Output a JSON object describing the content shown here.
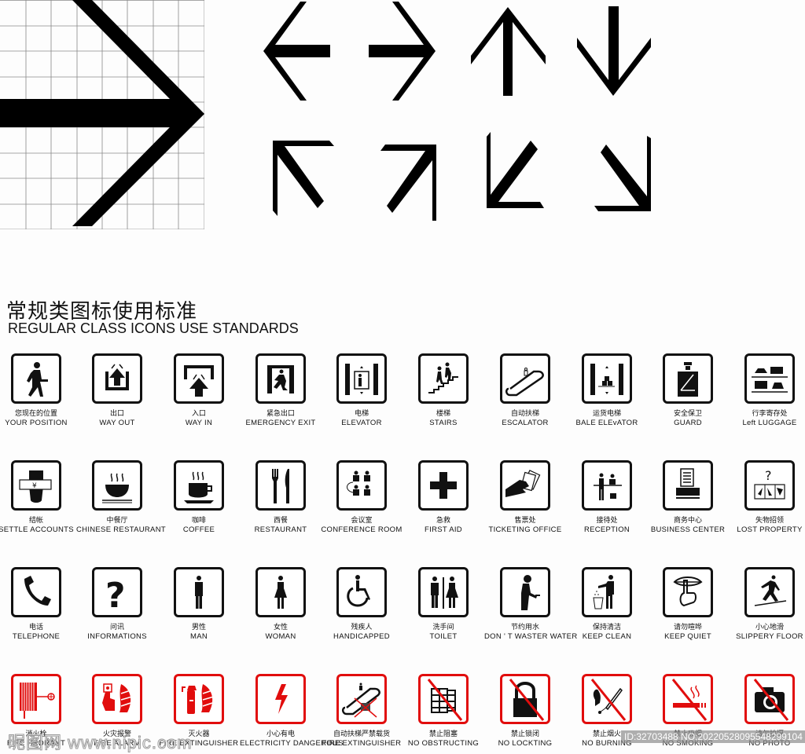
{
  "heading": {
    "title_cn": "常规类图标使用标准",
    "title_en": "REGULAR CLASS ICONS USE STANDARDS"
  },
  "arrows": [
    {
      "icon": "arrow-left-icon"
    },
    {
      "icon": "arrow-right-icon"
    },
    {
      "icon": "arrow-up-icon"
    },
    {
      "icon": "arrow-down-icon"
    },
    {
      "icon": "arrow-up-left-icon"
    },
    {
      "icon": "arrow-up-right-icon"
    },
    {
      "icon": "arrow-down-left-icon"
    },
    {
      "icon": "arrow-down-right-icon"
    }
  ],
  "grid_arrow": {
    "icon": "arrow-right-grid-icon"
  },
  "icons": [
    {
      "cn": "您现在的位置",
      "en": "YOUR  POSITION",
      "icon": "walking-person-icon",
      "color": "#111111"
    },
    {
      "cn": "出口",
      "en": "WAY  OUT",
      "icon": "way-out-icon",
      "color": "#111111"
    },
    {
      "cn": "入口",
      "en": "WAY  IN",
      "icon": "way-in-icon",
      "color": "#111111"
    },
    {
      "cn": "紧急出口",
      "en": "EMERGENCY  EXIT",
      "icon": "emergency-exit-icon",
      "color": "#111111"
    },
    {
      "cn": "电梯",
      "en": "ELEVATOR",
      "icon": "elevator-icon",
      "color": "#111111"
    },
    {
      "cn": "楼梯",
      "en": "STAIRS",
      "icon": "stairs-icon",
      "color": "#111111"
    },
    {
      "cn": "自动扶梯",
      "en": "ESCALATOR",
      "icon": "escalator-icon",
      "color": "#111111"
    },
    {
      "cn": "运货电梯",
      "en": "BALE ELEvATOR",
      "icon": "freight-elevator-icon",
      "color": "#111111"
    },
    {
      "cn": "安全保卫",
      "en": "GUARD",
      "icon": "guard-icon",
      "color": "#111111"
    },
    {
      "cn": "行李寄存处",
      "en": "Left LUGGAGE",
      "icon": "luggage-icon",
      "color": "#111111"
    },
    {
      "cn": "结帐",
      "en": "SETTLE  ACCOUNTS",
      "icon": "settle-accounts-icon",
      "color": "#111111"
    },
    {
      "cn": "中餐厅",
      "en": "CHINESE  RESTAURANT",
      "icon": "bowl-icon",
      "color": "#111111"
    },
    {
      "cn": "咖啡",
      "en": "COFFEE",
      "icon": "coffee-cup-icon",
      "color": "#111111"
    },
    {
      "cn": "西餐",
      "en": "RESTAURANT",
      "icon": "fork-knife-icon",
      "color": "#111111"
    },
    {
      "cn": "会议室",
      "en": "CONFERENCE  ROOM",
      "icon": "conference-room-icon",
      "color": "#111111"
    },
    {
      "cn": "急救",
      "en": "FIRST  AID",
      "icon": "first-aid-cross-icon",
      "color": "#111111"
    },
    {
      "cn": "售票处",
      "en": "TICKETING OFFICE",
      "icon": "ticket-hand-icon",
      "color": "#111111"
    },
    {
      "cn": "接待处",
      "en": "RECEPTION",
      "icon": "reception-icon",
      "color": "#111111"
    },
    {
      "cn": "商务中心",
      "en": "BUSINESS CENTER",
      "icon": "business-center-icon",
      "color": "#111111"
    },
    {
      "cn": "失物招领",
      "en": "LOST PROPERTY",
      "icon": "lost-property-icon",
      "color": "#111111"
    },
    {
      "cn": "电话",
      "en": "TELEPHONE",
      "icon": "telephone-icon",
      "color": "#111111"
    },
    {
      "cn": "问讯",
      "en": "INFORMATIONS",
      "icon": "question-mark-icon",
      "color": "#111111"
    },
    {
      "cn": "男性",
      "en": "MAN",
      "icon": "man-icon",
      "color": "#111111"
    },
    {
      "cn": "女性",
      "en": "WOMAN",
      "icon": "woman-icon",
      "color": "#111111"
    },
    {
      "cn": "残疾人",
      "en": "HANDICAPPED",
      "icon": "wheelchair-icon",
      "color": "#111111"
    },
    {
      "cn": "洗手间",
      "en": "TOILET",
      "icon": "toilet-icon",
      "color": "#111111"
    },
    {
      "cn": "节约用水",
      "en": "DON ' T WASTER WATER",
      "icon": "save-water-icon",
      "color": "#111111"
    },
    {
      "cn": "保持清洁",
      "en": "KEEP  CLEAN",
      "icon": "keep-clean-icon",
      "color": "#111111"
    },
    {
      "cn": "请勿喧哗",
      "en": "KEEP QUIET",
      "icon": "keep-quiet-icon",
      "color": "#111111"
    },
    {
      "cn": "小心地滑",
      "en": "SLIPPERY  FLOOR",
      "icon": "slippery-floor-icon",
      "color": "#111111"
    },
    {
      "cn": "消火栓",
      "en": "FIRE HRDRANT",
      "icon": "fire-hydrant-hose-icon",
      "color": "#e10d0d"
    },
    {
      "cn": "火灾报警",
      "en": "FIRE ALARM",
      "icon": "fire-alarm-icon",
      "color": "#e10d0d"
    },
    {
      "cn": "灭火器",
      "en": "FIRE  EXTINGUISHER",
      "icon": "fire-extinguisher-icon",
      "color": "#e10d0d"
    },
    {
      "cn": "小心有电",
      "en": "ELECTRICITY DANGEROUS",
      "icon": "electricity-icon",
      "color": "#e10d0d"
    },
    {
      "cn": "自动扶梯严禁载货",
      "en": "FIRE  EXTINGUISHER",
      "icon": "escalator-no-cargo-icon",
      "color": "#e10d0d"
    },
    {
      "cn": "禁止阻塞",
      "en": "NO OBSTRUCTING",
      "icon": "no-obstructing-icon",
      "color": "#e10d0d"
    },
    {
      "cn": "禁止锁闭",
      "en": "NO LOCKTING",
      "icon": "no-locking-icon",
      "color": "#e10d0d"
    },
    {
      "cn": "禁止烟火",
      "en": "NO BURNING",
      "icon": "no-burning-icon",
      "color": "#e10d0d"
    },
    {
      "cn": "禁止吸烟",
      "en": "NO SMOKING",
      "icon": "no-smoking-icon",
      "color": "#e10d0d"
    },
    {
      "cn": "请勿拍摄",
      "en": "NO PHOTO",
      "icon": "no-photo-icon",
      "color": "#e10d0d"
    }
  ],
  "watermark": {
    "left": "昵图网 www.nipic.com",
    "right": "ID:32703488 NO:20220528095548299104"
  }
}
